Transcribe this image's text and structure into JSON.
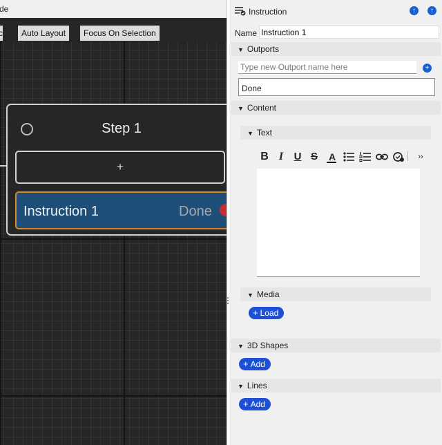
{
  "canvas": {
    "title_fragment": "de",
    "toolbar": {
      "partial_label": "c",
      "auto_layout_label": "Auto Layout",
      "focus_label": "Focus On Selection"
    },
    "node": {
      "title": "Step 1",
      "add_outport_symbol": "+",
      "instruction_title": "Instruction 1",
      "instruction_outport": "Done"
    }
  },
  "inspector": {
    "title": "Instruction",
    "name_label": "Name",
    "name_value": "Instruction 1",
    "outports": {
      "header": "Outports",
      "new_placeholder": "Type new Outport name here",
      "items": [
        "Done"
      ]
    },
    "content": {
      "header": "Content",
      "text_header": "Text",
      "media_header": "Media",
      "load_label": "Load"
    },
    "shapes": {
      "header": "3D Shapes",
      "add_label": "Add"
    },
    "lines": {
      "header": "Lines",
      "add_label": "Add"
    },
    "colors": {
      "accent": "#1e50d6",
      "instruction_fill": "#1f4e79",
      "instruction_border": "#d58a25",
      "port": "#c43030"
    }
  }
}
